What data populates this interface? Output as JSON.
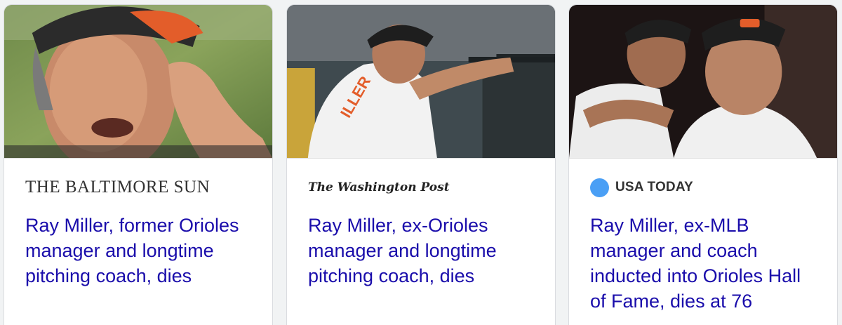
{
  "cards": [
    {
      "source": "THE BALTIMORE SUN",
      "headline": "Ray Miller, former Orioles manager and longtime pitching coach, dies"
    },
    {
      "source": "The Washington Post",
      "headline": "Ray Miller, ex-Orioles manager and longtime pitching coach, dies"
    },
    {
      "source": "USA TODAY",
      "headline": "Ray Miller, ex-MLB manager and coach inducted into Orioles Hall of Fame, dies at 76"
    }
  ],
  "colors": {
    "headline_link": "#1a0dab",
    "usa_today_dot": "#4a9ff5"
  }
}
